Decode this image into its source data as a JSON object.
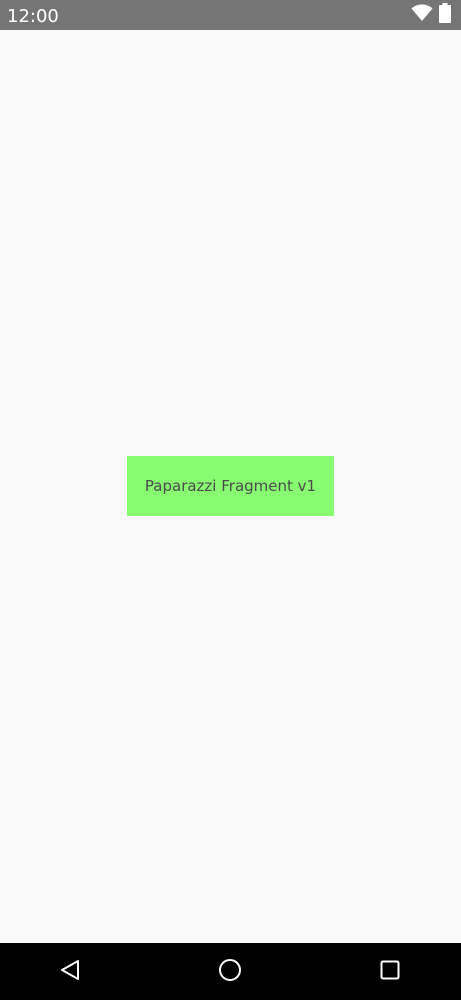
{
  "status_bar": {
    "time": "12:00",
    "icons": [
      "wifi-icon",
      "battery-icon"
    ],
    "background": "#757575"
  },
  "fragment": {
    "label": "Paparazzi Fragment v1",
    "background": "#88fd72"
  },
  "nav_bar": {
    "buttons": [
      "back-icon",
      "home-icon",
      "recents-icon"
    ],
    "background": "#000000"
  },
  "colors": {
    "screen_background": "#fafafa",
    "label_text": "#4a4a4a"
  }
}
